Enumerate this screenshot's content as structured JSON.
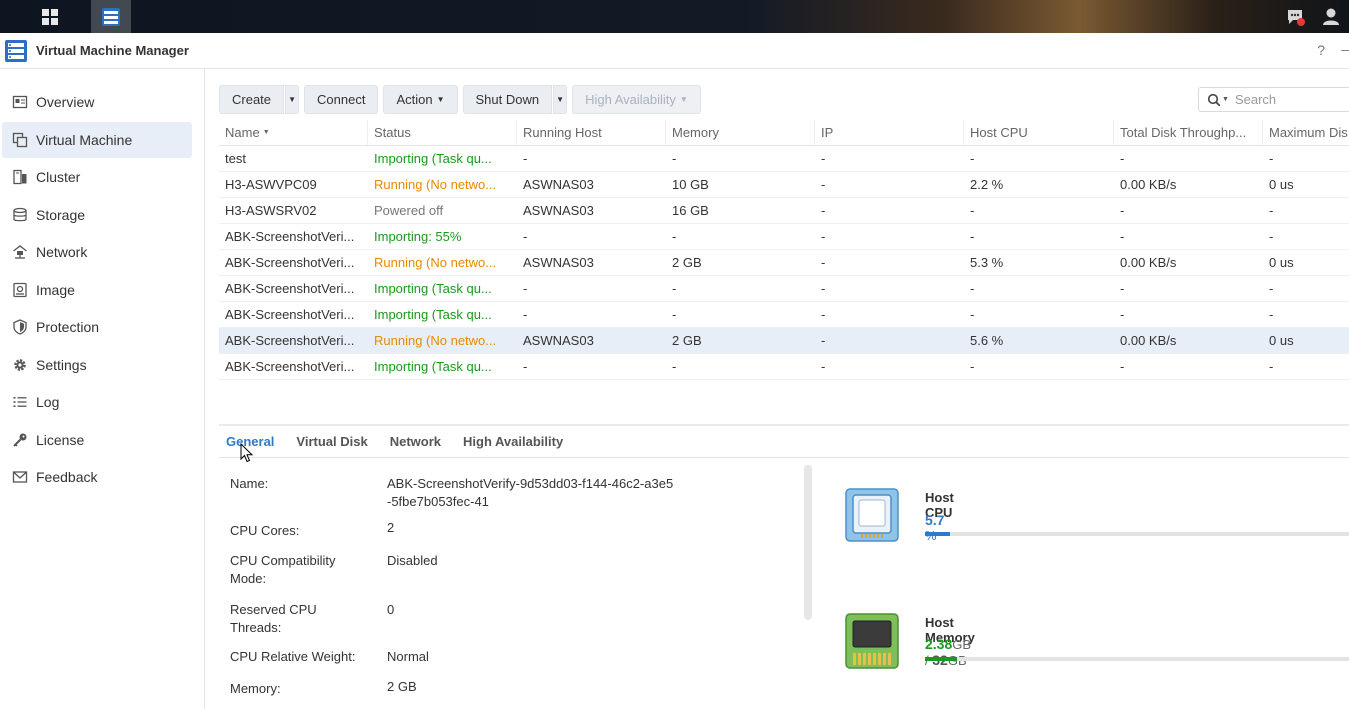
{
  "app": {
    "title": "Virtual Machine Manager",
    "help": "?",
    "minimize": "–"
  },
  "sidebar": {
    "items": [
      {
        "label": "Overview",
        "icon": "overview-icon"
      },
      {
        "label": "Virtual Machine",
        "icon": "virtual-machine-icon"
      },
      {
        "label": "Cluster",
        "icon": "cluster-icon"
      },
      {
        "label": "Storage",
        "icon": "storage-icon"
      },
      {
        "label": "Network",
        "icon": "network-icon"
      },
      {
        "label": "Image",
        "icon": "image-icon"
      },
      {
        "label": "Protection",
        "icon": "shield-icon"
      },
      {
        "label": "Settings",
        "icon": "gear-icon"
      },
      {
        "label": "Log",
        "icon": "log-icon"
      },
      {
        "label": "License",
        "icon": "key-icon"
      },
      {
        "label": "Feedback",
        "icon": "mail-icon"
      }
    ]
  },
  "toolbar": {
    "create": "Create",
    "connect": "Connect",
    "action": "Action",
    "shutdown": "Shut Down",
    "high_availability": "High Availability",
    "search_placeholder": "Search"
  },
  "table": {
    "columns": [
      "Name",
      "Status",
      "Running Host",
      "Memory",
      "IP",
      "Host CPU",
      "Total Disk Throughp...",
      "Maximum Dis"
    ],
    "rows": [
      {
        "name": "test",
        "status": "Importing (Task qu...",
        "status_kind": "green",
        "host": "-",
        "memory": "-",
        "ip": "-",
        "cpu": "-",
        "disk": "-",
        "max": "-"
      },
      {
        "name": "H3-ASWVPC09",
        "status": "Running (No netwo...",
        "status_kind": "orange",
        "host": "ASWNAS03",
        "memory": "10 GB",
        "ip": "-",
        "cpu": "2.2 %",
        "disk": "0.00 KB/s",
        "max": "0 us"
      },
      {
        "name": "H3-ASWSRV02",
        "status": "Powered off",
        "status_kind": "gray",
        "host": "ASWNAS03",
        "memory": "16 GB",
        "ip": "-",
        "cpu": "-",
        "disk": "-",
        "max": "-"
      },
      {
        "name": "ABK-ScreenshotVeri...",
        "status": "Importing: 55%",
        "status_kind": "green",
        "host": "-",
        "memory": "-",
        "ip": "-",
        "cpu": "-",
        "disk": "-",
        "max": "-"
      },
      {
        "name": "ABK-ScreenshotVeri...",
        "status": "Running (No netwo...",
        "status_kind": "orange",
        "host": "ASWNAS03",
        "memory": "2 GB",
        "ip": "-",
        "cpu": "5.3 %",
        "disk": "0.00 KB/s",
        "max": "0 us"
      },
      {
        "name": "ABK-ScreenshotVeri...",
        "status": "Importing (Task qu...",
        "status_kind": "green",
        "host": "-",
        "memory": "-",
        "ip": "-",
        "cpu": "-",
        "disk": "-",
        "max": "-"
      },
      {
        "name": "ABK-ScreenshotVeri...",
        "status": "Importing (Task qu...",
        "status_kind": "green",
        "host": "-",
        "memory": "-",
        "ip": "-",
        "cpu": "-",
        "disk": "-",
        "max": "-"
      },
      {
        "name": "ABK-ScreenshotVeri...",
        "status": "Running (No netwo...",
        "status_kind": "orange",
        "host": "ASWNAS03",
        "memory": "2 GB",
        "ip": "-",
        "cpu": "5.6 %",
        "disk": "0.00 KB/s",
        "max": "0 us",
        "selected": true
      },
      {
        "name": "ABK-ScreenshotVeri...",
        "status": "Importing (Task qu...",
        "status_kind": "green",
        "host": "-",
        "memory": "-",
        "ip": "-",
        "cpu": "-",
        "disk": "-",
        "max": "-"
      }
    ]
  },
  "detail_tabs": [
    "General",
    "Virtual Disk",
    "Network",
    "High Availability"
  ],
  "details": [
    {
      "label": "Name:",
      "value": "ABK-ScreenshotVerify-9d53dd03-f144-46c2-a3e5-5fbe7b053fec-41"
    },
    {
      "label": "CPU Cores:",
      "value": "2"
    },
    {
      "label": "CPU Compatibility Mode:",
      "value": "Disabled"
    },
    {
      "label": "Reserved CPU Threads:",
      "value": "0"
    },
    {
      "label": "CPU Relative Weight:",
      "value": "Normal"
    },
    {
      "label": "Memory:",
      "value": "2 GB"
    }
  ],
  "resources": {
    "cpu": {
      "title": "Host CPU",
      "value": "5.7",
      "unit": "%",
      "percent": 5.7,
      "color": "#2f79c9"
    },
    "memory": {
      "title": "Host Memory",
      "used": "2.38",
      "used_unit": "GB",
      "sep": "/",
      "total": "32",
      "total_unit": "GB",
      "percent": 7.4,
      "color": "#1a9a1a"
    }
  }
}
